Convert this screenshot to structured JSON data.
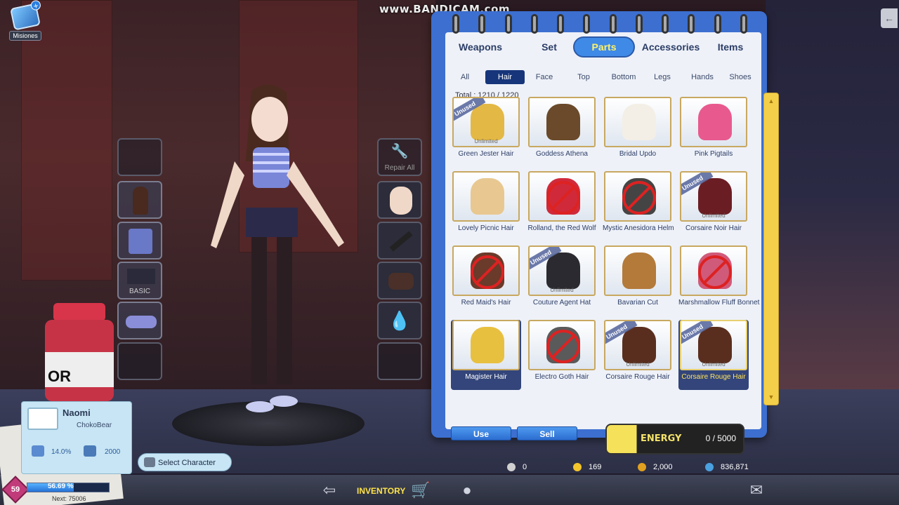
{
  "watermark": "www.BANDICAM.com",
  "misiones": {
    "label": "Misiones",
    "icon": "mission-book-icon"
  },
  "repair": {
    "label": "Repair All",
    "icon": "wrench-icon"
  },
  "tabs": [
    "Weapons",
    "Set",
    "Parts",
    "Accessories",
    "Items"
  ],
  "active_tab": "Parts",
  "subtabs": [
    "All",
    "Hair",
    "Face",
    "Top",
    "Bottom",
    "Legs",
    "Hands",
    "Shoes"
  ],
  "active_subtab": "Hair",
  "total": "Total :  1210  /  1220",
  "items": [
    {
      "name": "Green Jester Hair",
      "unused": true,
      "unlimited": "Unlimited",
      "banned": false,
      "color": "#e3b845"
    },
    {
      "name": "Goddess Athena",
      "unused": false,
      "unlimited": "",
      "banned": false,
      "color": "#6a4a2a"
    },
    {
      "name": "Bridal Updo",
      "unused": false,
      "unlimited": "",
      "banned": false,
      "color": "#f3efe6"
    },
    {
      "name": "Pink Pigtails",
      "unused": false,
      "unlimited": "",
      "banned": false,
      "color": "#e85a8e"
    },
    {
      "name": "Lovely Picnic Hair",
      "unused": false,
      "unlimited": "",
      "banned": false,
      "color": "#e8c890"
    },
    {
      "name": "Rolland, the Red Wolf",
      "unused": false,
      "unlimited": "",
      "banned": true,
      "color": "#d02a3a"
    },
    {
      "name": "Mystic Anesidora Helm",
      "unused": false,
      "unlimited": "",
      "banned": true,
      "color": "#444444"
    },
    {
      "name": "Corsaire Noir Hair",
      "unused": true,
      "unlimited": "Unlimited",
      "banned": false,
      "color": "#6a1e24"
    },
    {
      "name": "Red Maid's Hair",
      "unused": false,
      "unlimited": "",
      "banned": true,
      "color": "#6a3a2a"
    },
    {
      "name": "Couture Agent Hat",
      "unused": true,
      "unlimited": "Unlimited",
      "banned": false,
      "color": "#2a2a30"
    },
    {
      "name": "Bavarian Cut",
      "unused": false,
      "unlimited": "",
      "banned": false,
      "color": "#b47a3a"
    },
    {
      "name": "Marshmallow Fluff Bonnet",
      "unused": false,
      "unlimited": "",
      "banned": true,
      "color": "#d05a7a"
    },
    {
      "name": "Magister Hair",
      "unused": false,
      "unlimited": "",
      "banned": false,
      "color": "#e8c040"
    },
    {
      "name": "Electro Goth Hair",
      "unused": false,
      "unlimited": "",
      "banned": true,
      "color": "#5a5a5a"
    },
    {
      "name": "Corsaire Rouge Hair",
      "unused": true,
      "unlimited": "Unlimited",
      "banned": false,
      "color": "#5a2e1e"
    },
    {
      "name": "Corsaire Rouge Hair",
      "unused": true,
      "unlimited": "Unlimited",
      "banned": false,
      "color": "#5a2e1e"
    }
  ],
  "selected_item": 15,
  "buttons": {
    "use": "Use",
    "sell": "Sell"
  },
  "energy": {
    "label": "ENERGY",
    "value": "0  /  5000"
  },
  "currency": [
    {
      "icon": "gem-icon",
      "value": "0",
      "color": "#cccccc"
    },
    {
      "icon": "gold-coin-icon",
      "value": "169",
      "color": "#f3c52a"
    },
    {
      "icon": "token-icon",
      "value": "2,000",
      "color": "#e0a020"
    },
    {
      "icon": "gp-icon",
      "value": "836,871",
      "color": "#4aa0e0"
    }
  ],
  "character": {
    "name": "Naomi",
    "account": "ChokoBear",
    "stat1": "14.0%",
    "stat2": "2000"
  },
  "select_character": "Select Character",
  "level": "59",
  "xp": {
    "percent_label": "56.69 %",
    "fraction": 0.5669,
    "next": "Next:  75006"
  },
  "inventory_label": "INVENTORY",
  "jar_label": "OR"
}
